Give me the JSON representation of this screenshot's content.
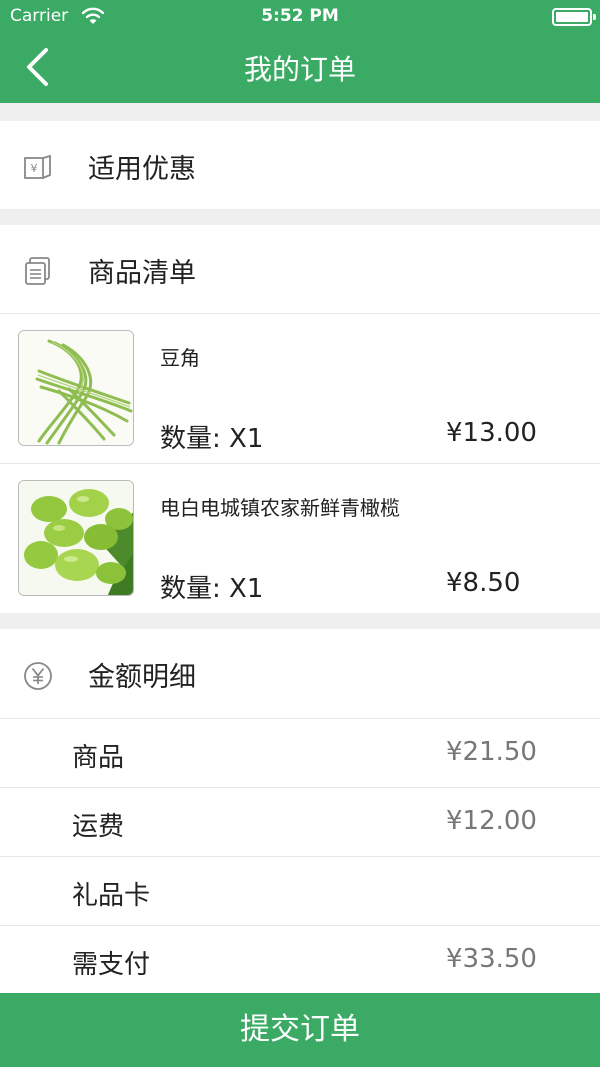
{
  "status_bar": {
    "carrier": "Carrier",
    "time": "5:52 PM"
  },
  "nav": {
    "title": "我的订单",
    "back_icon": "chevron-left-icon"
  },
  "coupon": {
    "label": "适用优惠",
    "icon": "coupon-icon"
  },
  "goods": {
    "label": "商品清单",
    "icon": "list-icon",
    "items": [
      {
        "name": "豆角",
        "qty": "数量: X1",
        "price": "¥13.00",
        "image": "green-beans"
      },
      {
        "name": "电白电城镇农家新鲜青橄榄",
        "qty": "数量: X1",
        "price": "¥8.50",
        "image": "green-olives"
      }
    ]
  },
  "amount": {
    "label": "金额明细",
    "icon": "yen-circle-icon",
    "rows": [
      {
        "label": "商品",
        "value": "¥21.50"
      },
      {
        "label": "运费",
        "value": "¥12.00"
      },
      {
        "label": "礼品卡",
        "value": ""
      },
      {
        "label": "需支付",
        "value": "¥33.50"
      }
    ]
  },
  "submit": {
    "label": "提交订单"
  },
  "colors": {
    "brand_green": "#3aaa64",
    "background": "#efefef",
    "muted_text": "#777777"
  }
}
